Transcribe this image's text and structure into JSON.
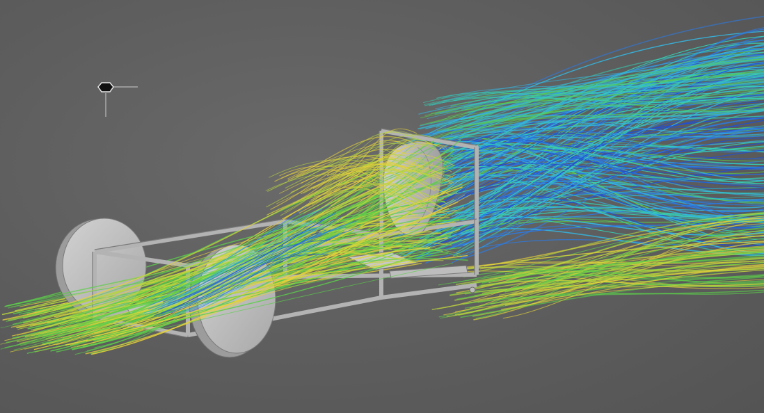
{
  "viewport": {
    "background": "#5f5f5f"
  },
  "light_gizmo": {
    "icon": "light-gizmo-icon"
  },
  "model": {
    "body_color": "#c9c9c9",
    "frame_color": "#b0b0b0",
    "wheel_face": "#bdbdbd",
    "wheel_rim": "#9a9a9a",
    "outline": "#6f6f6f"
  },
  "streamlines": {
    "palette": [
      "#1e4fd8",
      "#2a7be8",
      "#34b6e0",
      "#35d1b6",
      "#5ccf4a",
      "#b7d63c",
      "#e6d23a"
    ]
  }
}
